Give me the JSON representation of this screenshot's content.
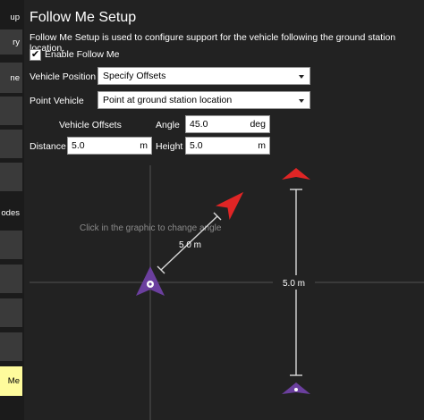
{
  "sidebar": {
    "items": [
      {
        "label": "up"
      },
      {
        "label": "ry"
      },
      {
        "label": "ne"
      },
      {
        "label": ""
      },
      {
        "label": ""
      },
      {
        "label": ""
      },
      {
        "label": "odes"
      },
      {
        "label": ""
      },
      {
        "label": ""
      },
      {
        "label": ""
      },
      {
        "label": ""
      },
      {
        "label": "Me"
      }
    ]
  },
  "page": {
    "title": "Follow Me Setup",
    "description": "Follow Me Setup is used to configure support for the vehicle following the ground station location.",
    "enable_label": "Enable Follow Me",
    "enable_checked": true
  },
  "vehicle_position": {
    "label": "Vehicle Position",
    "value": "Specify Offsets"
  },
  "point_vehicle": {
    "label": "Point Vehicle",
    "value": "Point at ground station location"
  },
  "offsets": {
    "header": "Vehicle Offsets",
    "angle_label": "Angle",
    "angle_value": "45.0",
    "angle_unit": "deg",
    "distance_label": "Distance",
    "distance_value": "5.0",
    "distance_unit": "m",
    "height_label": "Height",
    "height_value": "5.0",
    "height_unit": "m"
  },
  "graphic": {
    "hint": "Click in the graphic to change angle",
    "distance_label": "5.0 m",
    "height_label": "5.0 m",
    "angle_deg": 45,
    "colors": {
      "vehicle": "#e02020",
      "gcs": "#6a3d9a",
      "lines": "#555555",
      "measure": "#dddddd"
    }
  }
}
